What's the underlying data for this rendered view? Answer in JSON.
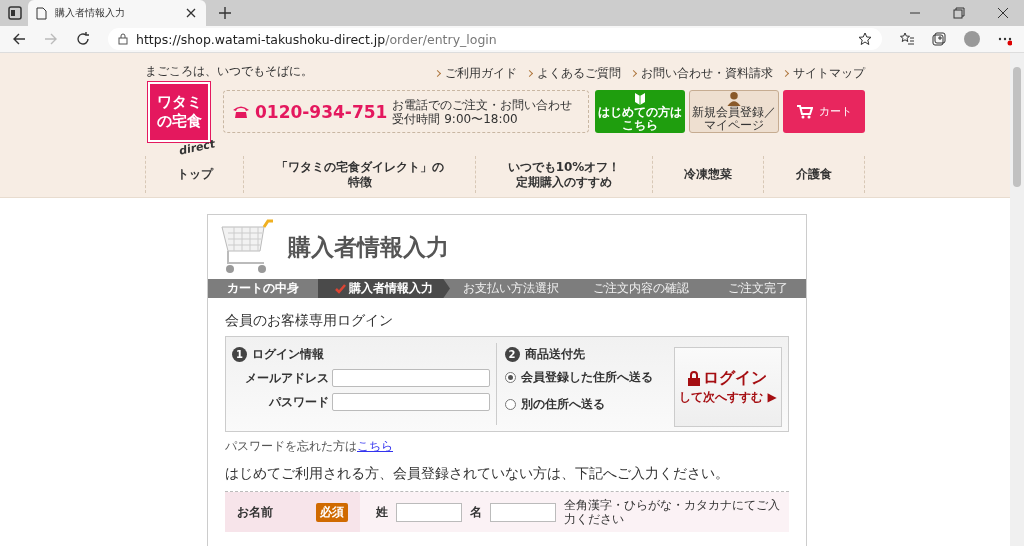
{
  "browser": {
    "tab_title": "購入者情報入力",
    "url_host": "https://shop.watami-takushoku-direct.jp",
    "url_path": "/order/entry_login"
  },
  "header": {
    "tagline": "まごころは、いつでもそばに。",
    "logo_lines": [
      "ワタミ",
      "の宅食"
    ],
    "logo_sub": "direct",
    "top_links": [
      "ご利用ガイド",
      "よくあるご質問",
      "お問い合わせ・資料請求",
      "サイトマップ"
    ],
    "phone": {
      "number": "0120-934-751",
      "note_lines": [
        "お電話でのご注文・お問い合わせ",
        "受付時間 9:00〜18:00"
      ]
    },
    "buttons": [
      {
        "kind": "first",
        "lines": [
          "はじめての方は",
          "こちら"
        ]
      },
      {
        "kind": "member",
        "lines": [
          "新規会員登録／",
          "マイページ"
        ]
      },
      {
        "kind": "cart",
        "lines": [
          "カート"
        ]
      }
    ],
    "nav": [
      {
        "lines": [
          "トップ"
        ]
      },
      {
        "lines": [
          "「ワタミの宅食ダイレクト」の",
          "特徴"
        ]
      },
      {
        "lines": [
          "いつでも10%オフ！",
          "定期購入のすすめ"
        ]
      },
      {
        "lines": [
          "冷凍惣菜"
        ]
      },
      {
        "lines": [
          "介護食"
        ]
      }
    ]
  },
  "page_title": "購入者情報入力",
  "steps": [
    {
      "label": "カートの中身",
      "selected": false,
      "done": true
    },
    {
      "label": "購入者情報入力",
      "selected": true,
      "done": true
    },
    {
      "label": "お支払い方法選択",
      "selected": false,
      "done": false
    },
    {
      "label": "ご注文内容の確認",
      "selected": false,
      "done": false
    },
    {
      "label": "ご注文完了",
      "selected": false,
      "done": false
    }
  ],
  "login": {
    "title": "会員のお客様専用ログイン",
    "section_1": {
      "number": "1",
      "title": "ログイン情報",
      "fields": [
        {
          "label": "メールアドレス"
        },
        {
          "label": "パスワード"
        }
      ]
    },
    "section_2": {
      "number": "2",
      "title": "商品送付先",
      "options": [
        {
          "label": "会員登録した住所へ送る",
          "selected": true
        },
        {
          "label": "別の住所へ送る",
          "selected": false
        }
      ]
    },
    "button": {
      "line_1": "ログイン",
      "line_2": "して次へすすむ ▶"
    },
    "forgot": {
      "text": "パスワードを忘れた方は",
      "link": "こちら"
    }
  },
  "register": {
    "title": "はじめてご利用される方、会員登録されていない方は、下記へご入力ください。",
    "row": {
      "label": "お名前",
      "badge": "必須",
      "field_1": "姓",
      "field_2": "名",
      "hint": "全角漢字・ひらがな・カタカナにてご入力ください"
    }
  }
}
